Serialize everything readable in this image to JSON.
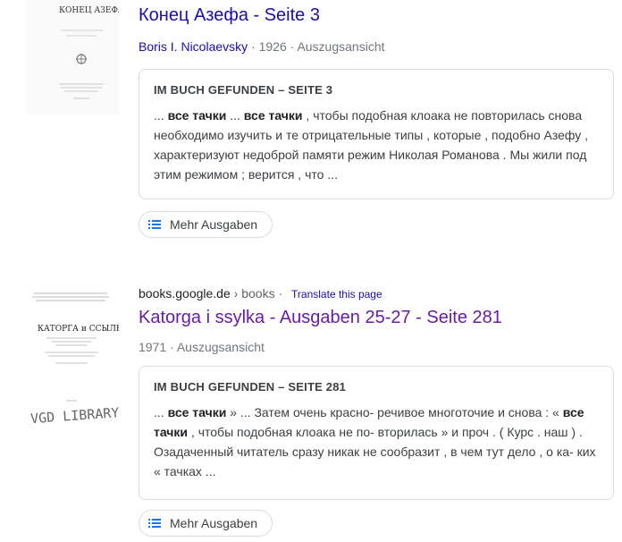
{
  "results": [
    {
      "title": "Конец Азефа - Seite 3",
      "author": "Boris I. Nicolaevsky",
      "year": "1926",
      "view": "Auszugsansicht",
      "snippet_heading": "IM BUCH GEFUNDEN – SEITE 3",
      "snippet_parts": [
        {
          "t": "... ",
          "b": false
        },
        {
          "t": "все тачки",
          "b": true
        },
        {
          "t": " ... ",
          "b": false
        },
        {
          "t": "все тачки",
          "b": true
        },
        {
          "t": " , чтобы подобная клоака не повторилась снова необходимо изучить и те отрицательные типы , которые , подобно Азефу , характеризуют недоброй памяти режим Николая Романова . Мы жили под этим режимом ; верится , что ...",
          "b": false
        }
      ],
      "more_label": "Mehr Ausgaben",
      "cover_title": "КОНЕЦ АЗЕФА"
    },
    {
      "source_domain": "books.google.de",
      "source_path": "› books",
      "translate_label": "Translate this page",
      "title": "Katorga i ssylka - Ausgaben 25-27 - Seite 281",
      "year": "1971",
      "view": "Auszugsansicht",
      "snippet_heading": "IM BUCH GEFUNDEN – SEITE 281",
      "snippet_parts": [
        {
          "t": "... ",
          "b": false
        },
        {
          "t": "все тачки",
          "b": true
        },
        {
          "t": " » ... Затем очень красно- речивое многоточие и снова : « ",
          "b": false
        },
        {
          "t": "все тачки",
          "b": true
        },
        {
          "t": " , чтобы подобная клоака не по- вторилась » и проч . ( Курс . наш ) . Озадаченный читатель сразу никак не сообразит , в чем тут дело , о ка- ких « тачках ...",
          "b": false
        }
      ],
      "more_label": "Mehr Ausgaben",
      "cover_title": "КАТОРГА и ССЫЛКА",
      "cover_watermark": "VGD LIBRARY"
    }
  ]
}
